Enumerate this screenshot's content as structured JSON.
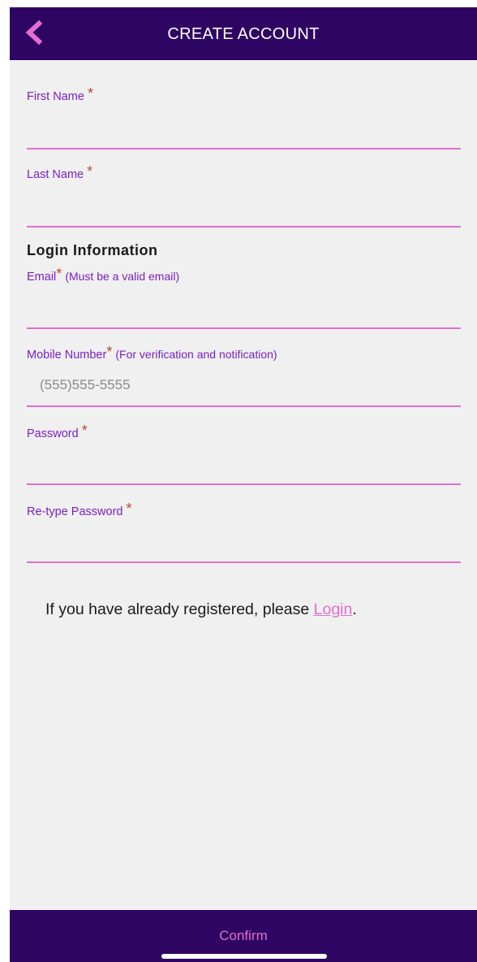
{
  "header": {
    "title": "CREATE ACCOUNT",
    "back_icon": "chevron-left-icon",
    "back_color": "#e26ed1",
    "background": "#2f0563"
  },
  "form": {
    "required_marker": "*",
    "first_name": {
      "label": "First Name",
      "value": "",
      "placeholder": ""
    },
    "last_name": {
      "label": "Last Name",
      "value": "",
      "placeholder": ""
    },
    "login_section_title": "Login Information",
    "email": {
      "label": "Email",
      "hint": "(Must be a valid email)",
      "value": "",
      "placeholder": ""
    },
    "mobile": {
      "label": "Mobile Number",
      "hint": "(For verification and notification)",
      "value": "",
      "placeholder": "(555)555-5555"
    },
    "password": {
      "label": "Password",
      "value": "",
      "placeholder": ""
    },
    "retype_password": {
      "label": "Re-type Password",
      "value": "",
      "placeholder": ""
    }
  },
  "login_note": {
    "prefix": "If you have already registered, please ",
    "link": "Login",
    "suffix": "."
  },
  "footer": {
    "confirm_label": "Confirm"
  },
  "colors": {
    "accent": "#e26ed1",
    "label": "#7a1fc2",
    "required": "#b84a2e",
    "bar": "#2f0563"
  }
}
